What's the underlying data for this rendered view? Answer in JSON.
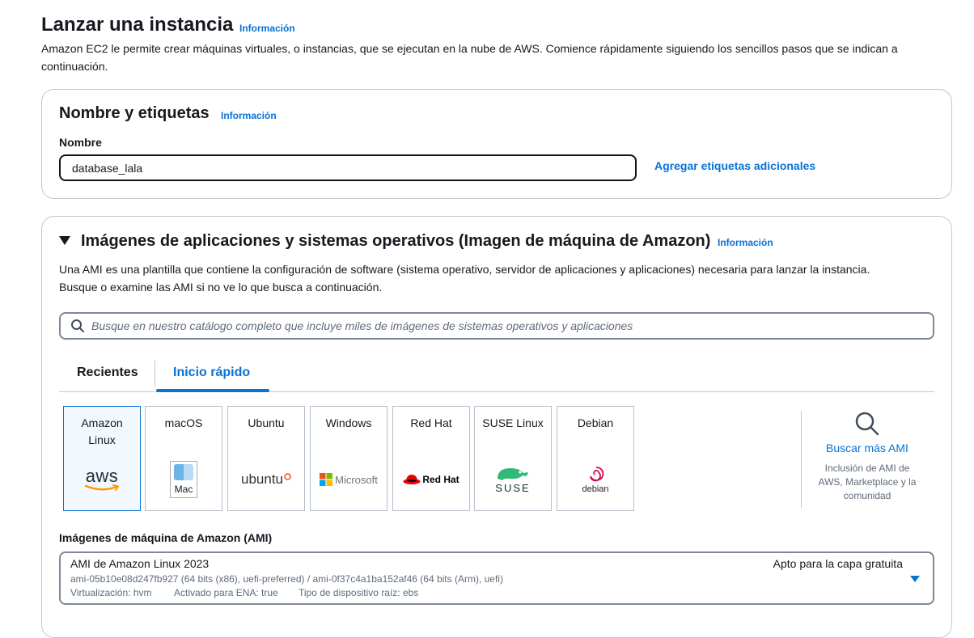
{
  "header": {
    "title": "Lanzar una instancia",
    "info": "Información",
    "description": "Amazon EC2 le permite crear máquinas virtuales, o instancias, que se ejecutan en la nube de AWS. Comience rápidamente siguiendo los sencillos pasos que se indican a continuación."
  },
  "name_panel": {
    "title": "Nombre y etiquetas",
    "info": "Información",
    "name_label": "Nombre",
    "name_value": "database_lala",
    "add_tags": "Agregar etiquetas adicionales"
  },
  "ami_panel": {
    "title": "Imágenes de aplicaciones y sistemas operativos (Imagen de máquina de Amazon)",
    "info": "Información",
    "description_1": "Una AMI es una plantilla que contiene la configuración de software (sistema operativo, servidor de aplicaciones y aplicaciones) necesaria para lanzar la instancia.",
    "description_2": "Busque o examine las AMI si no ve lo que busca a continuación.",
    "search_placeholder": "Busque en nuestro catálogo completo que incluye miles de imágenes de sistemas operativos y aplicaciones",
    "tabs": [
      {
        "label": "Recientes",
        "active": false
      },
      {
        "label": "Inicio rápido",
        "active": true
      }
    ],
    "tiles": [
      {
        "name_line1": "Amazon",
        "name_line2": "Linux",
        "logo_text": "aws",
        "selected": true
      },
      {
        "name_line1": "macOS",
        "logo_text": "Mac"
      },
      {
        "name_line1": "Ubuntu",
        "logo_text": "ubuntu"
      },
      {
        "name_line1": "Windows",
        "logo_text": "Microsoft"
      },
      {
        "name_line1": "Red Hat",
        "logo_text": "Red Hat"
      },
      {
        "name_line1": "SUSE Linux",
        "logo_text": "SUSE"
      },
      {
        "name_line1": "Debian",
        "logo_text": "debian"
      }
    ],
    "browse_more": {
      "label": "Buscar más AMI",
      "line1": "Inclusión de AMI de",
      "line2": "AWS, Marketplace y la",
      "line3": "comunidad"
    },
    "ami_label": "Imágenes de máquina de Amazon (AMI)",
    "ami_selected": {
      "name": "AMI de Amazon Linux 2023",
      "ids": "ami-05b10e08d247fb927 (64 bits (x86), uefi-preferred) / ami-0f37c4a1ba152af46 (64 bits (Arm), uefi)",
      "virt": "Virtualización: hvm",
      "ena": "Activado para ENA: true",
      "root": "Tipo de dispositivo raíz: ebs",
      "free_tier": "Apto para la capa gratuita"
    }
  },
  "colors": {
    "link": "#0972d3",
    "text": "#16191f",
    "border": "#c6c6cd",
    "selected_bg": "#f2f8fd"
  }
}
